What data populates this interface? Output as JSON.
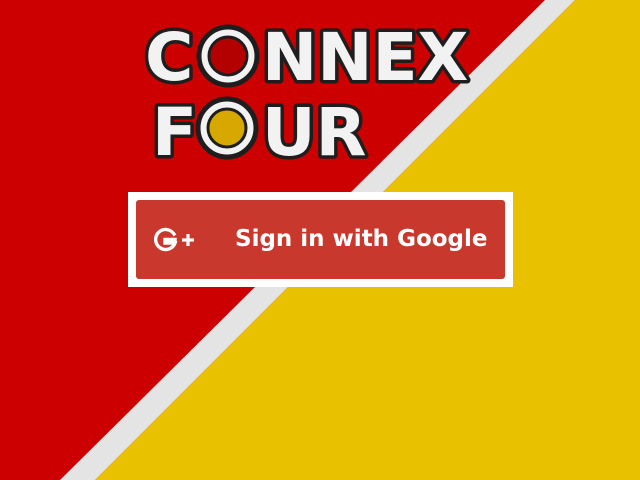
{
  "logo": {
    "line1": [
      "C",
      "NNEX"
    ],
    "line2": [
      "F",
      "UR"
    ],
    "red_disc_color": "#b30000",
    "yellow_disc_color": "#d6a800"
  },
  "signin": {
    "label": "Sign in with Google",
    "icon": "google-plus-icon",
    "button_color": "#c9382c"
  },
  "background": {
    "red": "#cc0000",
    "yellow": "#e8c100",
    "divider": "#e4e4e4"
  }
}
